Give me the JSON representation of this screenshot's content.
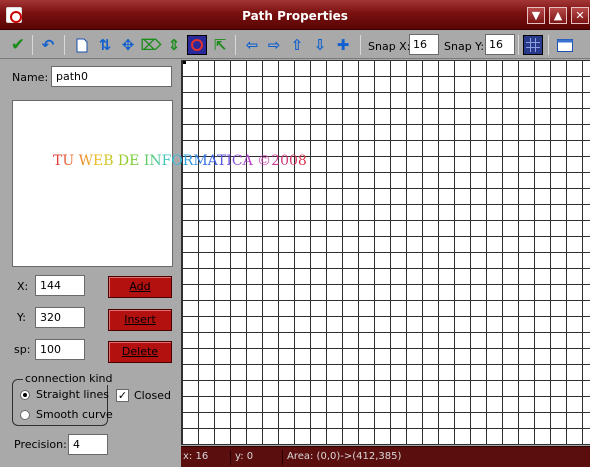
{
  "window": {
    "title": "Path Properties",
    "controls": [
      "minimize-icon",
      "maximize-icon",
      "close-icon"
    ]
  },
  "toolbar": {
    "icons": [
      "ok-check-icon",
      "undo-icon",
      "new-path-icon",
      "reverse-icon",
      "center-icon",
      "mirror-horizontal-icon",
      "flip-vertical-icon",
      "rotate-icon",
      "scale-icon",
      "shift-left-icon",
      "shift-right-icon",
      "shift-up-icon",
      "shift-down-icon",
      "center-view-icon"
    ],
    "snap_x_label": "Snap X:",
    "snap_x_value": "16",
    "snap_y_label": "Snap Y:",
    "snap_y_value": "16",
    "grid_toggle": "grid-icon",
    "room_toggle": "room-icon"
  },
  "panel": {
    "name_label": "Name:",
    "name_value": "path0",
    "watermark": "TU WEB DE INFORMATICA ©2008",
    "x_label": "X:",
    "x_value": "144",
    "y_label": "Y:",
    "y_value": "320",
    "sp_label": "sp:",
    "sp_value": "100",
    "add_label": "Add",
    "insert_label": "Insert",
    "delete_label": "Delete",
    "connection_kind_label": "connection kind",
    "straight_lines_label": "Straight lines",
    "smooth_curve_label": "Smooth curve",
    "closed_label": "Closed",
    "closed_checked": true,
    "connection_selected": "Straight lines",
    "precision_label": "Precision:",
    "precision_value": "4"
  },
  "status": {
    "x": "x: 16",
    "y": "y: 0",
    "area": "Area: (0,0)->(412,385)"
  },
  "colors": {
    "titlebar": "#7a1010",
    "button_red": "#b31010",
    "panel_gray": "#a9a9a9",
    "grid_line": "#303030"
  }
}
